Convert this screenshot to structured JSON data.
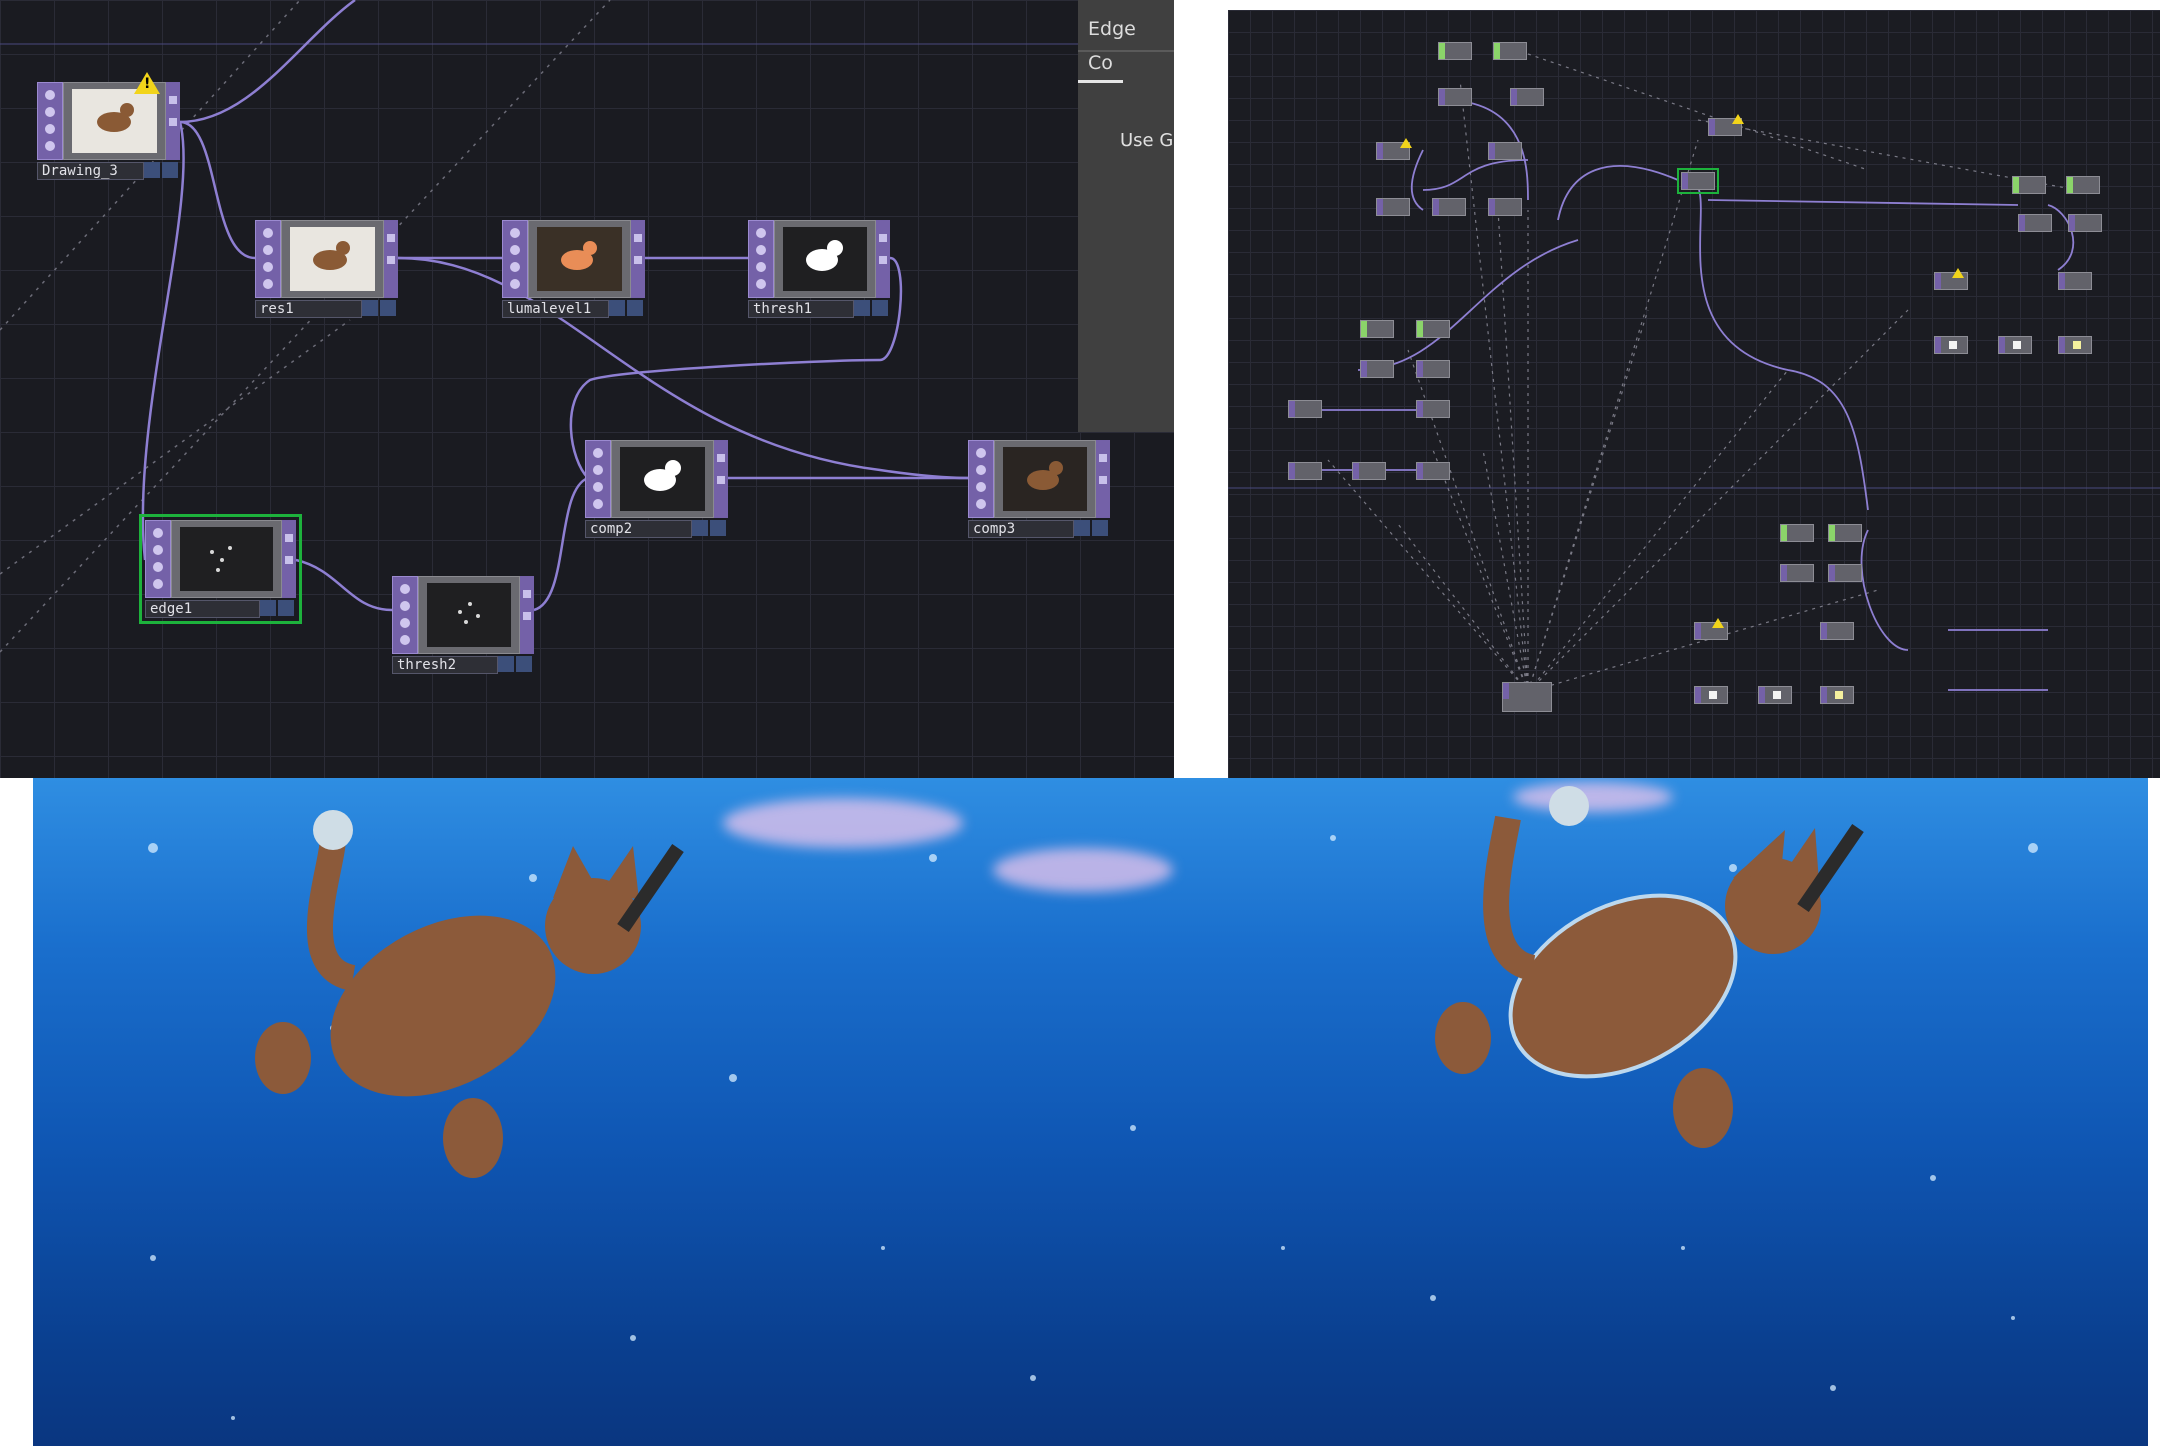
{
  "left_editor": {
    "param_panel": {
      "tabs": [
        "Edge",
        "Co"
      ],
      "use_label": "Use G"
    },
    "nodes": {
      "drawing": "Drawing_3",
      "res": "res1",
      "lumalevel": "lumalevel1",
      "thresh1": "thresh1",
      "edge": "edge1",
      "thresh2": "thresh2",
      "comp2": "comp2",
      "comp3": "comp3"
    },
    "warning_symbol": "!"
  },
  "right_editor": {
    "warning_symbol": "!"
  },
  "colors": {
    "editor_bg": "#1a1b21",
    "node_purple": "#7461a8",
    "wire": "#8e7fd2",
    "selection": "#1db23c",
    "warning": "#f2d41a",
    "water_top": "#2f8ee2",
    "water_bottom": "#0a3680"
  },
  "icons": [
    "warning-icon"
  ]
}
